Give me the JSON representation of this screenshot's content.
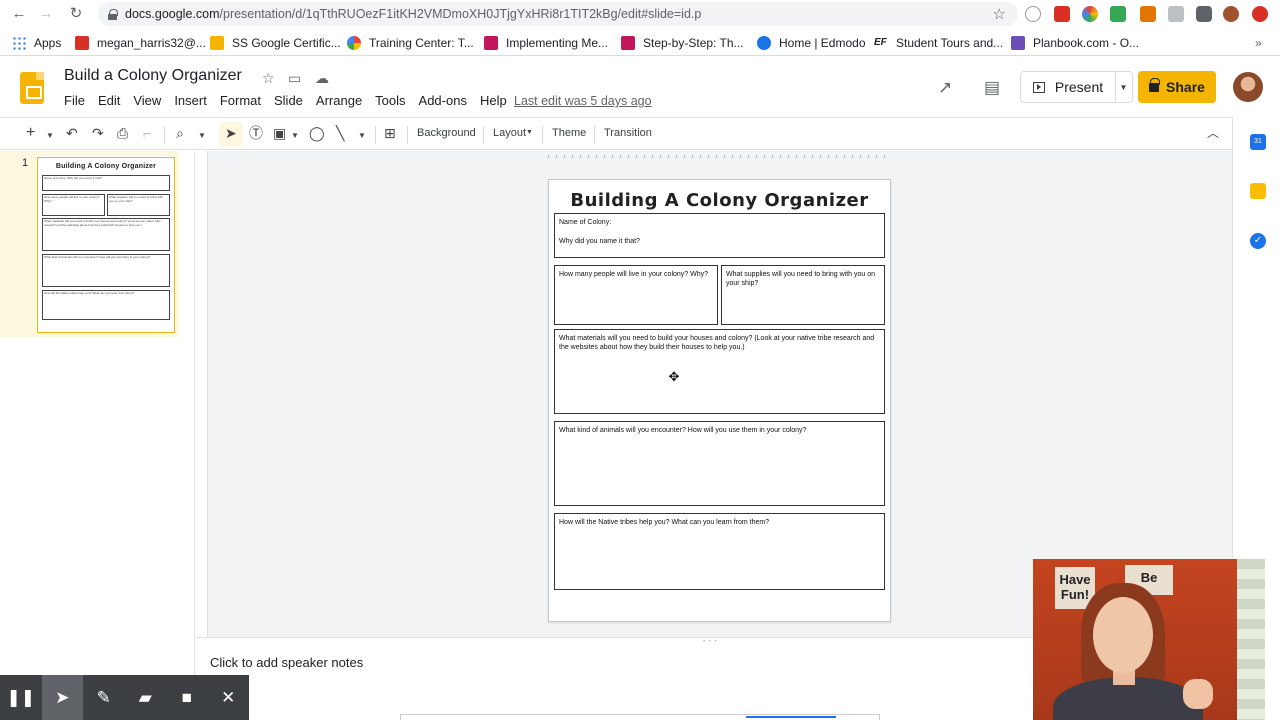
{
  "browser": {
    "url_host": "docs.google.com",
    "url_path": "/presentation/d/1qTthRUOezF1itKH2VMDmoXH0JTjgYxHRi8r1TIT2kBg/edit#slide=id.p",
    "bookmarks": [
      {
        "label": "Apps",
        "icon": "apps-grid-icon",
        "color": "#4285f4"
      },
      {
        "label": "megan_harris32@...",
        "icon": "gmail-icon",
        "color": "#d93025"
      },
      {
        "label": "SS Google Certific...",
        "icon": "slides-icon",
        "color": "#f4b400"
      },
      {
        "label": "Training Center: T...",
        "icon": "google-icon",
        "color": "#4285f4"
      },
      {
        "label": "Implementing Me...",
        "icon": "bookmark-icon",
        "color": "#c2185b"
      },
      {
        "label": "Step-by-Step: Th...",
        "icon": "bookmark-icon",
        "color": "#c2185b"
      },
      {
        "label": "Home | Edmodo",
        "icon": "edmodo-icon",
        "color": "#1a73e8"
      },
      {
        "label": "Student Tours and...",
        "icon": "ef-icon",
        "color": "#202124"
      },
      {
        "label": "Planbook.com - O...",
        "icon": "planbook-icon",
        "color": "#6a4fb6"
      }
    ]
  },
  "header": {
    "doc_title": "Build a Colony Organizer",
    "menu": [
      "File",
      "Edit",
      "View",
      "Insert",
      "Format",
      "Slide",
      "Arrange",
      "Tools",
      "Add-ons",
      "Help"
    ],
    "last_edit": "Last edit was 5 days ago",
    "present_label": "Present",
    "share_label": "Share",
    "accent": "#f4b400"
  },
  "toolbar": {
    "background_label": "Background",
    "layout_label": "Layout",
    "theme_label": "Theme",
    "transition_label": "Transition"
  },
  "filmstrip": {
    "slide_number": "1"
  },
  "slide": {
    "title": "Building A Colony Organizer",
    "box1_line1": "Name of Colony:",
    "box1_line2": "Why did you name it that?",
    "box2": "How many people will live in your colony? Why?",
    "box3": "What supplies will you need to bring with you on your ship?",
    "box4": "What materials will you need to build your houses and colony? (Look at your native tribe research and the websites about how they build their houses to help you.)",
    "box5": "What kind of animals will you encounter? How will you use them in your colony?",
    "box6": "How will the Native tribes help you? What can you learn from them?"
  },
  "thumbnail": {
    "title": "Building A Colony Organizer",
    "box1": "Name of Colony: Why did you name it that?",
    "box2": "How many people will live in your colony? Why?",
    "box3": "What supplies will you need to bring with you on your ship?",
    "box4": "What materials will you need to build your houses and colony? (Look at your native tribe research and the websites about how they build their houses to help you.)",
    "box5": "What kind of animals will you encounter? How will you use them in your colony?",
    "box6": "How will the Native tribes help you? What can you learn from them?"
  },
  "notes": {
    "placeholder": "Click to add speaker notes"
  },
  "webcam": {
    "sign1": "Have Fun!",
    "sign2": "Be"
  }
}
